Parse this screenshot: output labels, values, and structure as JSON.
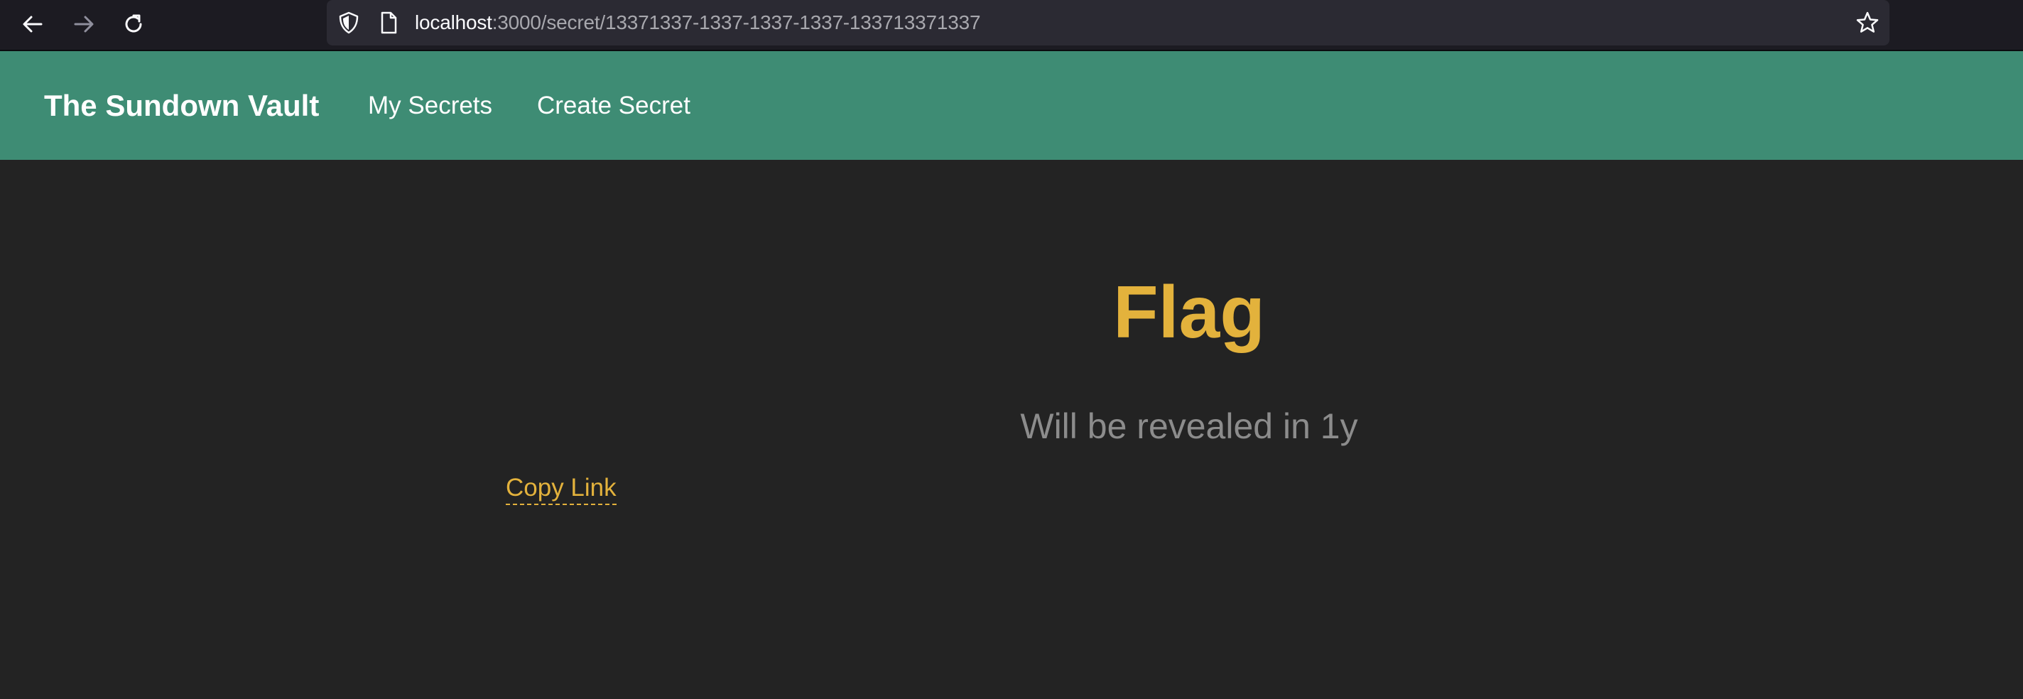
{
  "browser": {
    "url_host": "localhost",
    "url_path": ":3000/secret/13371337-1337-1337-1337-133713371337",
    "icons": {
      "back": "arrow-left-icon",
      "forward": "arrow-right-icon",
      "reload": "reload-icon",
      "shield": "shield-icon",
      "page": "page-icon",
      "bookmark": "star-icon"
    }
  },
  "header": {
    "brand": "The Sundown Vault",
    "nav": [
      {
        "label": "My Secrets"
      },
      {
        "label": "Create Secret"
      }
    ]
  },
  "secret": {
    "title": "Flag",
    "reveal_text": "Will be revealed in 1y",
    "copy_link_label": "Copy Link"
  },
  "colors": {
    "header_bg": "#3e8c74",
    "page_bg": "#232323",
    "accent": "#e3b23c",
    "muted_text": "#8c8c8c",
    "browser_bg": "#1c1b22",
    "url_bar_bg": "#2b2a33"
  }
}
